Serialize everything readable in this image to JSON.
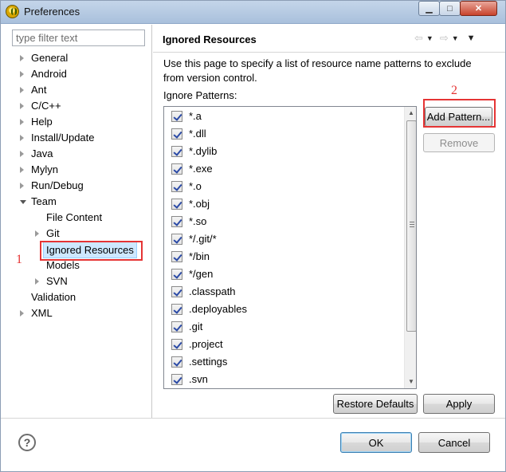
{
  "window": {
    "title": "Preferences"
  },
  "sidebar": {
    "filter_placeholder": "type filter text",
    "items": [
      {
        "label": "General"
      },
      {
        "label": "Android"
      },
      {
        "label": "Ant"
      },
      {
        "label": "C/C++"
      },
      {
        "label": "Help"
      },
      {
        "label": "Install/Update"
      },
      {
        "label": "Java"
      },
      {
        "label": "Mylyn"
      },
      {
        "label": "Run/Debug"
      },
      {
        "label": "Team"
      },
      {
        "label": "File Content"
      },
      {
        "label": "Git"
      },
      {
        "label": "Ignored Resources"
      },
      {
        "label": "Models"
      },
      {
        "label": "SVN"
      },
      {
        "label": "Validation"
      },
      {
        "label": "XML"
      }
    ]
  },
  "main": {
    "title": "Ignored Resources",
    "description": "Use this page to specify a list of resource name patterns to exclude from version control.",
    "patterns_label": "Ignore Patterns:",
    "patterns": [
      "*.a",
      "*.dll",
      "*.dylib",
      "*.exe",
      "*.o",
      "*.obj",
      "*.so",
      "*/.git/*",
      "*/bin",
      "*/gen",
      ".classpath",
      ".deployables",
      ".git",
      ".project",
      ".settings",
      ".svn"
    ],
    "add_pattern_label": "Add Pattern...",
    "remove_label": "Remove",
    "restore_defaults_label": "Restore Defaults",
    "apply_label": "Apply"
  },
  "footer": {
    "ok_label": "OK",
    "cancel_label": "Cancel"
  },
  "annotations": {
    "marker_1": "1",
    "marker_2": "2"
  },
  "colors": {
    "annotation_red": "#e53434",
    "selection_bg": "#cde8ff"
  }
}
